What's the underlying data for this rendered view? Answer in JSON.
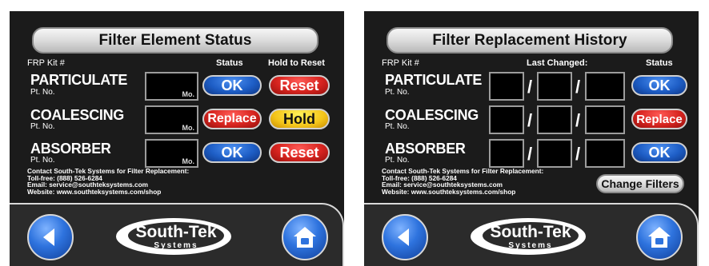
{
  "left": {
    "title": "Filter Element Status",
    "headers": {
      "frp": "FRP Kit #",
      "status": "Status",
      "hold": "Hold to Reset"
    },
    "rows": [
      {
        "name": "PARTICULATE",
        "pt": "Pt. No.",
        "mo": "Mo.",
        "status": "OK",
        "status_color": "#1e5ec6",
        "action": "Reset",
        "action_color": "#d7241f"
      },
      {
        "name": "COALESCING",
        "pt": "Pt. No.",
        "mo": "Mo.",
        "status": "Replace",
        "status_color": "#d7241f",
        "action": "Hold",
        "action_color": "#f4c51a"
      },
      {
        "name": "ABSORBER",
        "pt": "Pt. No.",
        "mo": "Mo.",
        "status": "OK",
        "status_color": "#1e5ec6",
        "action": "Reset",
        "action_color": "#d7241f"
      }
    ],
    "contact": [
      "Contact South-Tek Systems for Filter Replacement:",
      "Toll-free: (888) 526-6284",
      "Email: service@southteksystems.com",
      "Website: www.southteksystems.com/shop"
    ]
  },
  "right": {
    "title": "Filter Replacement History",
    "headers": {
      "frp": "FRP Kit #",
      "last_changed": "Last Changed:",
      "status": "Status"
    },
    "rows": [
      {
        "name": "PARTICULATE",
        "pt": "Pt. No.",
        "status": "OK",
        "status_color": "#1e5ec6"
      },
      {
        "name": "COALESCING",
        "pt": "Pt. No.",
        "status": "Replace",
        "status_color": "#d7241f"
      },
      {
        "name": "ABSORBER",
        "pt": "Pt. No.",
        "status": "OK",
        "status_color": "#1e5ec6"
      }
    ],
    "date_separator": "/",
    "contact": [
      "Contact South-Tek Systems for Filter Replacement:",
      "Toll-free: (888) 526-6284",
      "Email: service@southteksystems.com",
      "Website: www.southteksystems.com/shop"
    ],
    "change_filters": "Change Filters"
  },
  "logo": {
    "brand": "South-Tek",
    "sub": "Systems"
  },
  "icons": {
    "back": "back-arrow-icon",
    "home": "home-icon"
  }
}
